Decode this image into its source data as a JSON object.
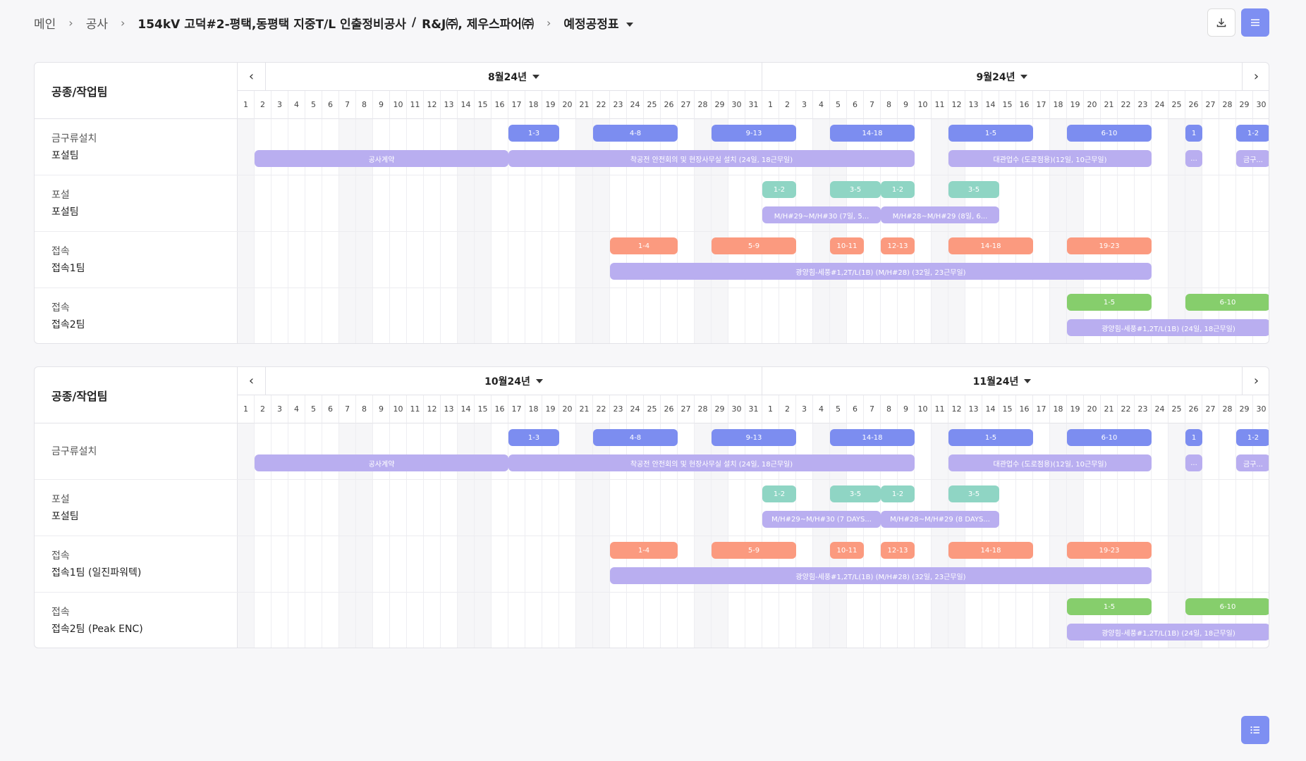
{
  "breadcrumb": {
    "home": "메인",
    "section": "공사",
    "project": "154kV 고덕#2-평택,동평택 지중T/L 인출정비공사",
    "divider": "/",
    "company": "R&J㈜, 제우스파어㈜",
    "current": "예정공정표"
  },
  "toolbar": {
    "download_icon": "download-icon",
    "menu_icon": "hamburger-menu-icon"
  },
  "fab": {
    "icon": "list-icon"
  },
  "colors": {
    "blue": "#7c8df0",
    "lavender": "#b9aef0",
    "teal": "#8fd5c4",
    "salmon": "#fb9a7f",
    "green": "#86ce6c",
    "accent": "#7e8ff2"
  },
  "panels": [
    {
      "header_label": "공종/작업팀",
      "prev_label": "‹",
      "next_label": "›",
      "months": [
        {
          "label": "8월24년",
          "days": 31
        },
        {
          "label": "9월24년",
          "days": 30
        }
      ],
      "rows": [
        {
          "line1": "금구류설치",
          "line2": "포설팀"
        },
        {
          "line1": "포설",
          "line2": "포설팀"
        },
        {
          "line1": "접속",
          "line2": "접속1팀"
        },
        {
          "line1": "접속",
          "line2": "접속2팀"
        }
      ],
      "bars": [
        {
          "row": 0,
          "lane": 0,
          "start": 17,
          "end": 19,
          "color": "blue",
          "label": "1-3"
        },
        {
          "row": 0,
          "lane": 0,
          "start": 22,
          "end": 26,
          "color": "blue",
          "label": "4-8"
        },
        {
          "row": 0,
          "lane": 0,
          "start": 29,
          "end": 33,
          "color": "blue",
          "label": "9-13"
        },
        {
          "row": 0,
          "lane": 0,
          "start": 36,
          "end": 40,
          "color": "blue",
          "label": "14-18"
        },
        {
          "row": 0,
          "lane": 0,
          "start": 43,
          "end": 47,
          "color": "blue",
          "label": "1-5"
        },
        {
          "row": 0,
          "lane": 0,
          "start": 50,
          "end": 54,
          "color": "blue",
          "label": "6-10"
        },
        {
          "row": 0,
          "lane": 0,
          "start": 57,
          "end": 57,
          "color": "blue",
          "label": "1"
        },
        {
          "row": 0,
          "lane": 0,
          "start": 60,
          "end": 61,
          "color": "blue",
          "label": "1-2"
        },
        {
          "row": 0,
          "lane": 1,
          "start": 2,
          "end": 16,
          "color": "lavender",
          "label": "공사계약"
        },
        {
          "row": 0,
          "lane": 1,
          "start": 17,
          "end": 40,
          "color": "lavender",
          "label": "착공전 안전회의 및 현장사무실 설치 (24일, 18근무일)"
        },
        {
          "row": 0,
          "lane": 1,
          "start": 43,
          "end": 54,
          "color": "lavender",
          "label": "대관업수 (도로점용)(12일, 10근무일)"
        },
        {
          "row": 0,
          "lane": 1,
          "start": 57,
          "end": 57,
          "color": "lavender",
          "label": "..."
        },
        {
          "row": 0,
          "lane": 1,
          "start": 60,
          "end": 61,
          "color": "lavender",
          "label": "금구..."
        },
        {
          "row": 1,
          "lane": 0,
          "start": 32,
          "end": 33,
          "color": "teal",
          "label": "1-2"
        },
        {
          "row": 1,
          "lane": 0,
          "start": 36,
          "end": 38,
          "color": "teal",
          "label": "3-5"
        },
        {
          "row": 1,
          "lane": 0,
          "start": 39,
          "end": 40,
          "color": "teal",
          "label": "1-2"
        },
        {
          "row": 1,
          "lane": 0,
          "start": 43,
          "end": 45,
          "color": "teal",
          "label": "3-5"
        },
        {
          "row": 1,
          "lane": 1,
          "start": 32,
          "end": 38,
          "color": "lavender",
          "label": "M/H#29~M/H#30 (7일, 5..."
        },
        {
          "row": 1,
          "lane": 1,
          "start": 39,
          "end": 45,
          "color": "lavender",
          "label": "M/H#28~M/H#29 (8일, 6..."
        },
        {
          "row": 2,
          "lane": 0,
          "start": 23,
          "end": 26,
          "color": "salmon",
          "label": "1-4"
        },
        {
          "row": 2,
          "lane": 0,
          "start": 29,
          "end": 33,
          "color": "salmon",
          "label": "5-9"
        },
        {
          "row": 2,
          "lane": 0,
          "start": 36,
          "end": 37,
          "color": "salmon",
          "label": "10-11"
        },
        {
          "row": 2,
          "lane": 0,
          "start": 39,
          "end": 40,
          "color": "salmon",
          "label": "12-13"
        },
        {
          "row": 2,
          "lane": 0,
          "start": 43,
          "end": 47,
          "color": "salmon",
          "label": "14-18"
        },
        {
          "row": 2,
          "lane": 0,
          "start": 50,
          "end": 54,
          "color": "salmon",
          "label": "19-23"
        },
        {
          "row": 2,
          "lane": 1,
          "start": 23,
          "end": 54,
          "color": "lavender",
          "label": "광양힘-세풍#1,2T/L(1B) (M/H#28) (32일, 23근무일)"
        },
        {
          "row": 3,
          "lane": 0,
          "start": 50,
          "end": 54,
          "color": "green",
          "label": "1-5"
        },
        {
          "row": 3,
          "lane": 0,
          "start": 57,
          "end": 61,
          "color": "green",
          "label": "6-10"
        },
        {
          "row": 3,
          "lane": 1,
          "start": 50,
          "end": 61,
          "color": "lavender",
          "label": "광양힘-세풍#1,2T/L(1B) (24일, 18근무일)"
        }
      ]
    },
    {
      "header_label": "공종/작업팀",
      "prev_label": "‹",
      "next_label": "›",
      "months": [
        {
          "label": "10월24년",
          "days": 31
        },
        {
          "label": "11월24년",
          "days": 30
        }
      ],
      "rows": [
        {
          "line1": "금구류설치",
          "line2": ""
        },
        {
          "line1": "포설",
          "line2": "포설팀"
        },
        {
          "line1": "접속",
          "line2": "접속1팀 (일진파워텍)"
        },
        {
          "line1": "접속",
          "line2": "접속2팀 (Peak ENC)"
        }
      ],
      "bars": [
        {
          "row": 0,
          "lane": 0,
          "start": 17,
          "end": 19,
          "color": "blue",
          "label": "1-3"
        },
        {
          "row": 0,
          "lane": 0,
          "start": 22,
          "end": 26,
          "color": "blue",
          "label": "4-8"
        },
        {
          "row": 0,
          "lane": 0,
          "start": 29,
          "end": 33,
          "color": "blue",
          "label": "9-13"
        },
        {
          "row": 0,
          "lane": 0,
          "start": 36,
          "end": 40,
          "color": "blue",
          "label": "14-18"
        },
        {
          "row": 0,
          "lane": 0,
          "start": 43,
          "end": 47,
          "color": "blue",
          "label": "1-5"
        },
        {
          "row": 0,
          "lane": 0,
          "start": 50,
          "end": 54,
          "color": "blue",
          "label": "6-10"
        },
        {
          "row": 0,
          "lane": 0,
          "start": 57,
          "end": 57,
          "color": "blue",
          "label": "1"
        },
        {
          "row": 0,
          "lane": 0,
          "start": 60,
          "end": 61,
          "color": "blue",
          "label": "1-2"
        },
        {
          "row": 0,
          "lane": 1,
          "start": 2,
          "end": 16,
          "color": "lavender",
          "label": "공사계약"
        },
        {
          "row": 0,
          "lane": 1,
          "start": 17,
          "end": 40,
          "color": "lavender",
          "label": "착공전 안전회의 및 현장사무실 설치 (24일, 18근무일)"
        },
        {
          "row": 0,
          "lane": 1,
          "start": 43,
          "end": 54,
          "color": "lavender",
          "label": "대관업수 (도로점용)(12일, 10근무일)"
        },
        {
          "row": 0,
          "lane": 1,
          "start": 57,
          "end": 57,
          "color": "lavender",
          "label": "..."
        },
        {
          "row": 0,
          "lane": 1,
          "start": 60,
          "end": 61,
          "color": "lavender",
          "label": "금구..."
        },
        {
          "row": 1,
          "lane": 0,
          "start": 32,
          "end": 33,
          "color": "teal",
          "label": "1-2"
        },
        {
          "row": 1,
          "lane": 0,
          "start": 36,
          "end": 38,
          "color": "teal",
          "label": "3-5"
        },
        {
          "row": 1,
          "lane": 0,
          "start": 39,
          "end": 40,
          "color": "teal",
          "label": "1-2"
        },
        {
          "row": 1,
          "lane": 0,
          "start": 43,
          "end": 45,
          "color": "teal",
          "label": "3-5"
        },
        {
          "row": 1,
          "lane": 1,
          "start": 32,
          "end": 38,
          "color": "lavender",
          "label": "M/H#29~M/H#30 (7 DAYS..."
        },
        {
          "row": 1,
          "lane": 1,
          "start": 39,
          "end": 45,
          "color": "lavender",
          "label": "M/H#28~M/H#29 (8 DAYS..."
        },
        {
          "row": 2,
          "lane": 0,
          "start": 23,
          "end": 26,
          "color": "salmon",
          "label": "1-4"
        },
        {
          "row": 2,
          "lane": 0,
          "start": 29,
          "end": 33,
          "color": "salmon",
          "label": "5-9"
        },
        {
          "row": 2,
          "lane": 0,
          "start": 36,
          "end": 37,
          "color": "salmon",
          "label": "10-11"
        },
        {
          "row": 2,
          "lane": 0,
          "start": 39,
          "end": 40,
          "color": "salmon",
          "label": "12-13"
        },
        {
          "row": 2,
          "lane": 0,
          "start": 43,
          "end": 47,
          "color": "salmon",
          "label": "14-18"
        },
        {
          "row": 2,
          "lane": 0,
          "start": 50,
          "end": 54,
          "color": "salmon",
          "label": "19-23"
        },
        {
          "row": 2,
          "lane": 1,
          "start": 23,
          "end": 54,
          "color": "lavender",
          "label": "광양힘-세풍#1,2T/L(1B) (M/H#28) (32일, 23근무일)"
        },
        {
          "row": 3,
          "lane": 0,
          "start": 50,
          "end": 54,
          "color": "green",
          "label": "1-5"
        },
        {
          "row": 3,
          "lane": 0,
          "start": 57,
          "end": 61,
          "color": "green",
          "label": "6-10"
        },
        {
          "row": 3,
          "lane": 1,
          "start": 50,
          "end": 61,
          "color": "lavender",
          "label": "광양힘-세풍#1,2T/L(1B) (24일, 18근무일)"
        }
      ]
    }
  ]
}
